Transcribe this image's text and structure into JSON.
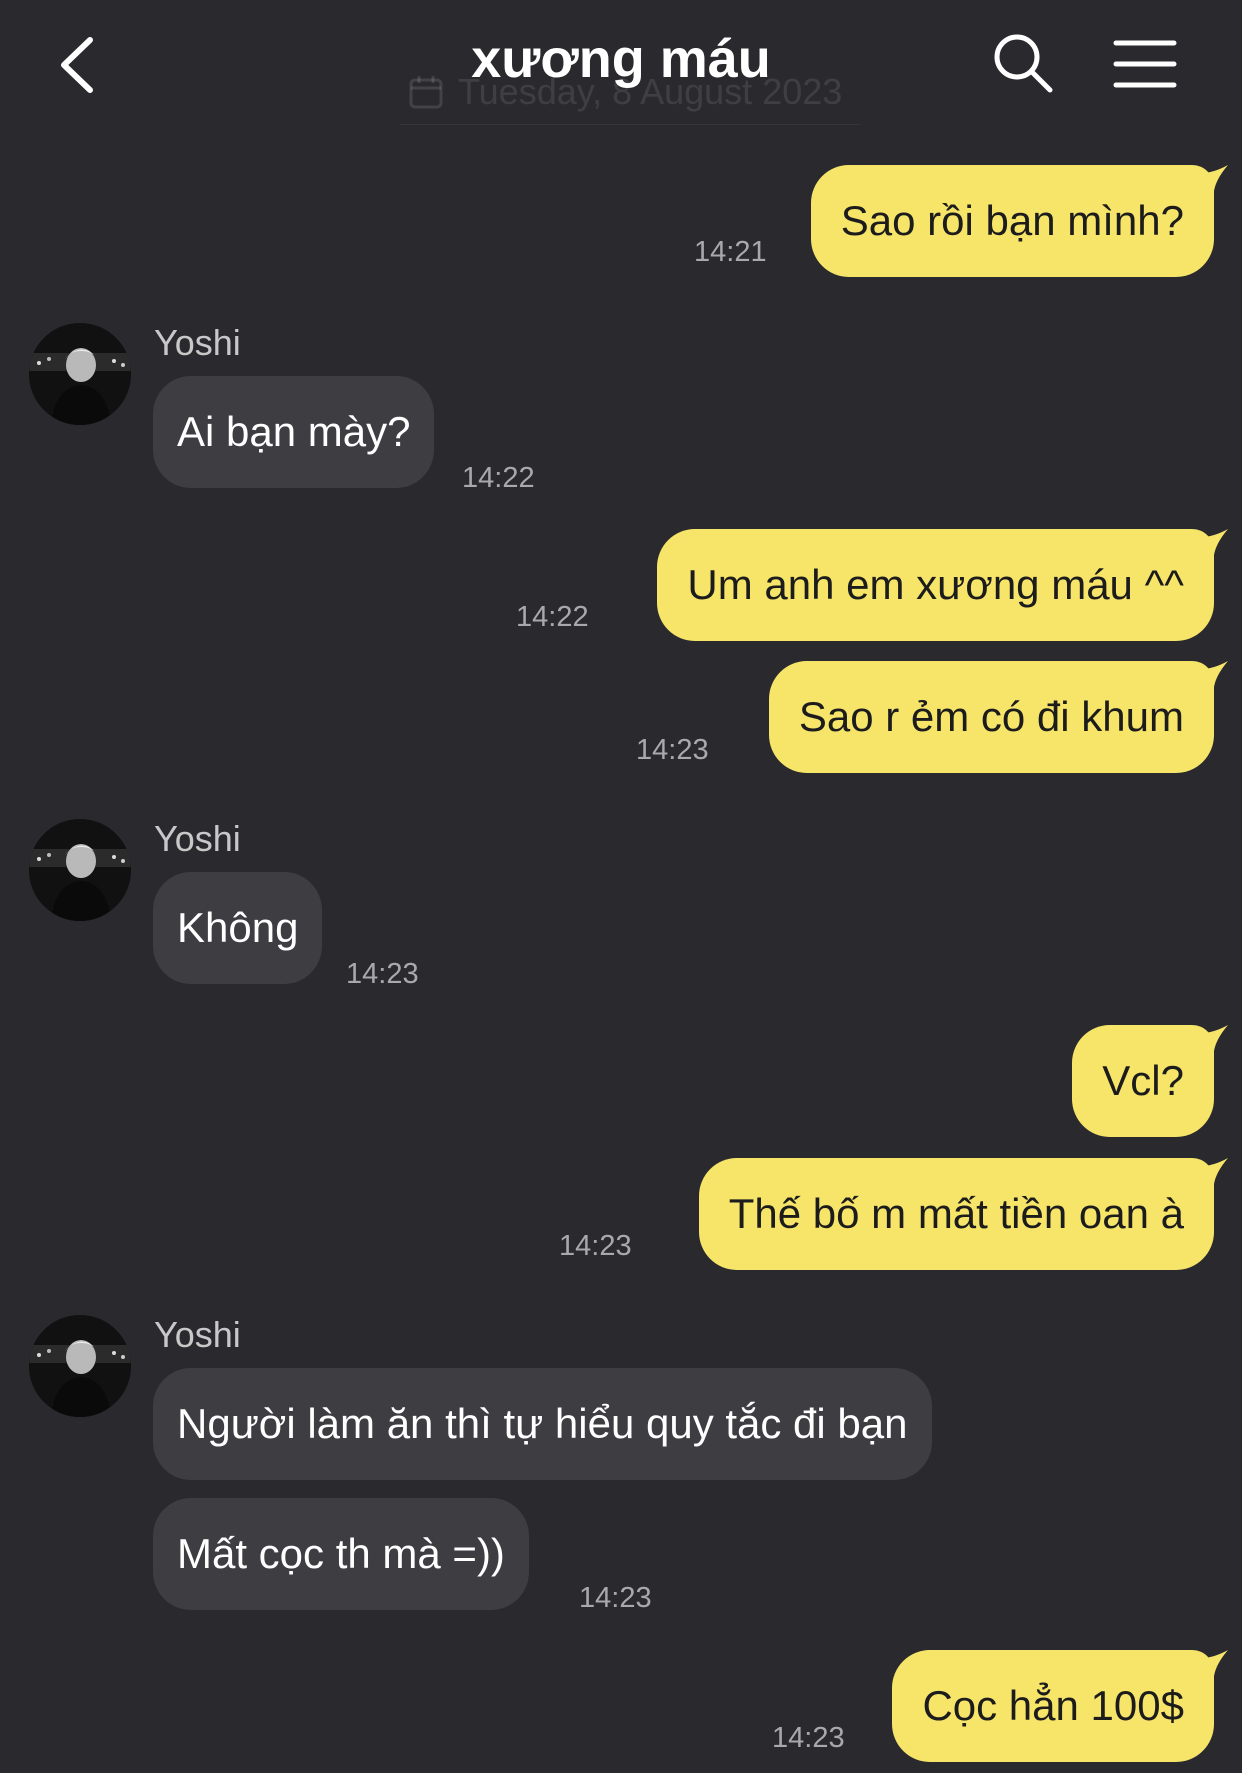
{
  "header": {
    "title": "xương máu",
    "back_icon": "chevron-left-icon",
    "search_icon": "search-icon",
    "menu_icon": "hamburger-menu-icon",
    "faded_date": "Tuesday, 8 August 2023"
  },
  "colors": {
    "background": "#2a2a2e",
    "outgoing_bubble": "#f7e56a",
    "incoming_bubble": "#3d3d42",
    "timestamp": "#a9a9ad"
  },
  "messages": [
    {
      "direction": "out",
      "text": "Sao rồi bạn mình?",
      "time": "14:21"
    },
    {
      "direction": "in",
      "sender": "Yoshi",
      "text": "Ai bạn mày?",
      "time": "14:22"
    },
    {
      "direction": "out",
      "text": "Um anh em xương máu ^^",
      "time": "14:22"
    },
    {
      "direction": "out",
      "text": "Sao r ẻm có đi khum",
      "time": "14:23"
    },
    {
      "direction": "in",
      "sender": "Yoshi",
      "text": "Không",
      "time": "14:23"
    },
    {
      "direction": "out",
      "text": "Vcl?",
      "time": ""
    },
    {
      "direction": "out",
      "text": "Thế bố m mất tiền oan à",
      "time": "14:23"
    },
    {
      "direction": "in",
      "sender": "Yoshi",
      "text": "Người làm ăn thì tự hiểu quy tắc đi bạn",
      "time": ""
    },
    {
      "direction": "in",
      "text": "Mất cọc th mà =))",
      "time": "14:23"
    },
    {
      "direction": "out",
      "text": "Cọc hẳn 100$",
      "time": "14:23"
    }
  ]
}
